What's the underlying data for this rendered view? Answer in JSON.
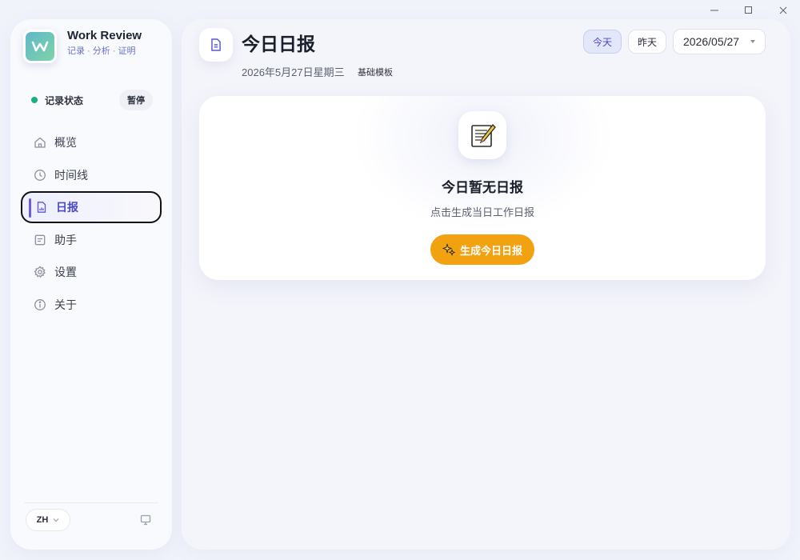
{
  "window": {
    "minimize_icon": "minimize-icon",
    "maximize_icon": "maximize-icon",
    "close_icon": "close-icon"
  },
  "brand": {
    "title": "Work Review",
    "subtitle": "记录 · 分析 · 证明"
  },
  "status": {
    "label": "记录状态",
    "pause_label": "暂停",
    "dot_color": "#16b07a"
  },
  "nav": {
    "items": [
      {
        "label": "概览",
        "icon": "home-icon"
      },
      {
        "label": "时间线",
        "icon": "clock-icon"
      },
      {
        "label": "日报",
        "icon": "report-icon",
        "active": true
      },
      {
        "label": "助手",
        "icon": "assistant-icon"
      },
      {
        "label": "设置",
        "icon": "gear-icon"
      },
      {
        "label": "关于",
        "icon": "info-icon"
      }
    ]
  },
  "footer": {
    "language": "ZH"
  },
  "header": {
    "title": "今日日报",
    "date_text": "2026年5月27日星期三",
    "template_tag": "基础模板",
    "today_label": "今天",
    "yesterday_label": "昨天",
    "date_value": "2026/05/27"
  },
  "empty_state": {
    "title": "今日暂无日报",
    "description": "点击生成当日工作日报",
    "button_label": "生成今日日报"
  },
  "colors": {
    "accent": "#5a56d6",
    "button": "#f2a111"
  }
}
